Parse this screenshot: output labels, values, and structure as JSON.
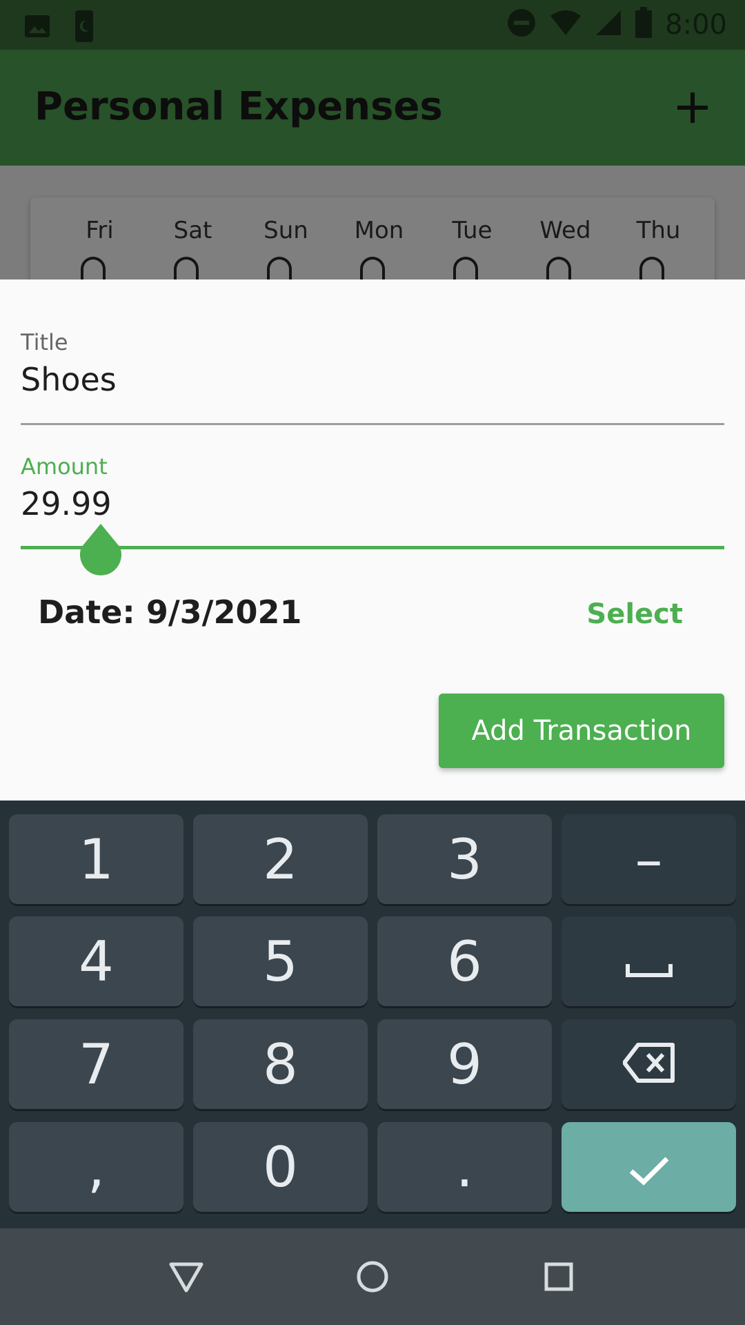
{
  "status_bar": {
    "time": "8:00",
    "icons": [
      "image-icon",
      "phone-icon",
      "do-not-disturb-icon",
      "wifi-icon",
      "cell-signal-icon",
      "battery-icon"
    ]
  },
  "app_bar": {
    "title": "Personal Expenses",
    "add_icon": "plus-icon"
  },
  "chart": {
    "days": [
      "Fri",
      "Sat",
      "Sun",
      "Mon",
      "Tue",
      "Wed",
      "Thu"
    ]
  },
  "form": {
    "title_label": "Title",
    "title_value": "Shoes",
    "amount_label": "Amount",
    "amount_value": "29.99",
    "date_text": "Date: 9/3/2021",
    "select_label": "Select",
    "submit_label": "Add Transaction"
  },
  "keyboard": {
    "rows": [
      [
        "1",
        "2",
        "3",
        "–"
      ],
      [
        "4",
        "5",
        "6",
        "space-icon"
      ],
      [
        "7",
        "8",
        "9",
        "backspace-icon"
      ],
      [
        ",",
        "0",
        ".",
        "check-icon"
      ]
    ]
  },
  "nav_bar": {
    "buttons": [
      "back-icon",
      "home-icon",
      "recents-icon"
    ]
  },
  "colors": {
    "accent": "#4caf50",
    "app_bar": "#285229",
    "keyboard_bg": "#263238",
    "enter_key": "#6cada6"
  }
}
